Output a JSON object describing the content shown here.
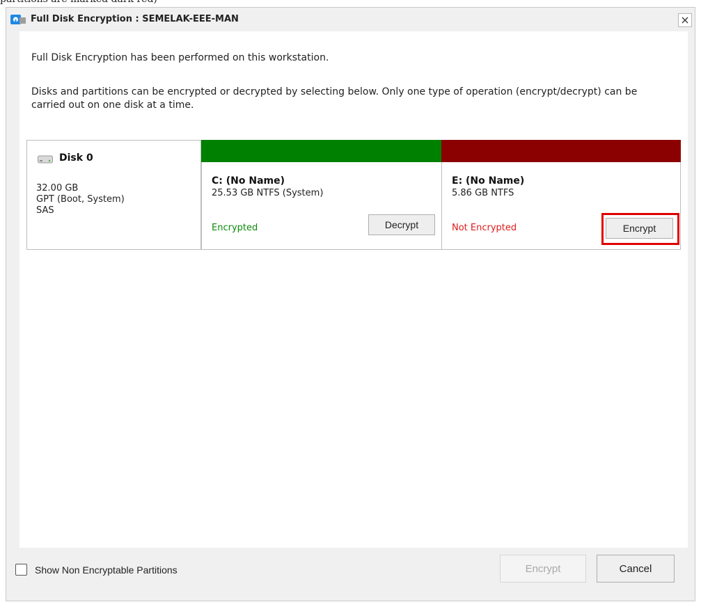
{
  "caption": "partitions are marked dark red)",
  "window": {
    "title": "Full Disk Encryption : SEMELAK-EEE-MAN"
  },
  "messages": {
    "performed": "Full Disk Encryption has been performed on this workstation.",
    "instructions": "Disks and partitions can be encrypted or decrypted by selecting below. Only one type of operation (encrypt/decrypt) can be carried out on one disk at a time."
  },
  "disk": {
    "name": "Disk 0",
    "size": "32.00 GB",
    "partition_style": "GPT (Boot, System)",
    "bus": "SAS"
  },
  "partitions": [
    {
      "name": "C: (No Name)",
      "detail": "25.53 GB NTFS (System)",
      "status": "Encrypted",
      "status_color": "#0a8a0a",
      "bar_color": "#008000",
      "action_label": "Decrypt"
    },
    {
      "name": "E: (No Name)",
      "detail": "5.86 GB NTFS",
      "status": "Not Encrypted",
      "status_color": "#e01b1b",
      "bar_color": "#8b0000",
      "action_label": "Encrypt"
    }
  ],
  "footer": {
    "show_non_encryptable_label": "Show Non Encryptable Partitions",
    "show_non_encryptable_checked": false,
    "encrypt_label": "Encrypt",
    "cancel_label": "Cancel"
  },
  "colors": {
    "highlight": "#e00000"
  }
}
